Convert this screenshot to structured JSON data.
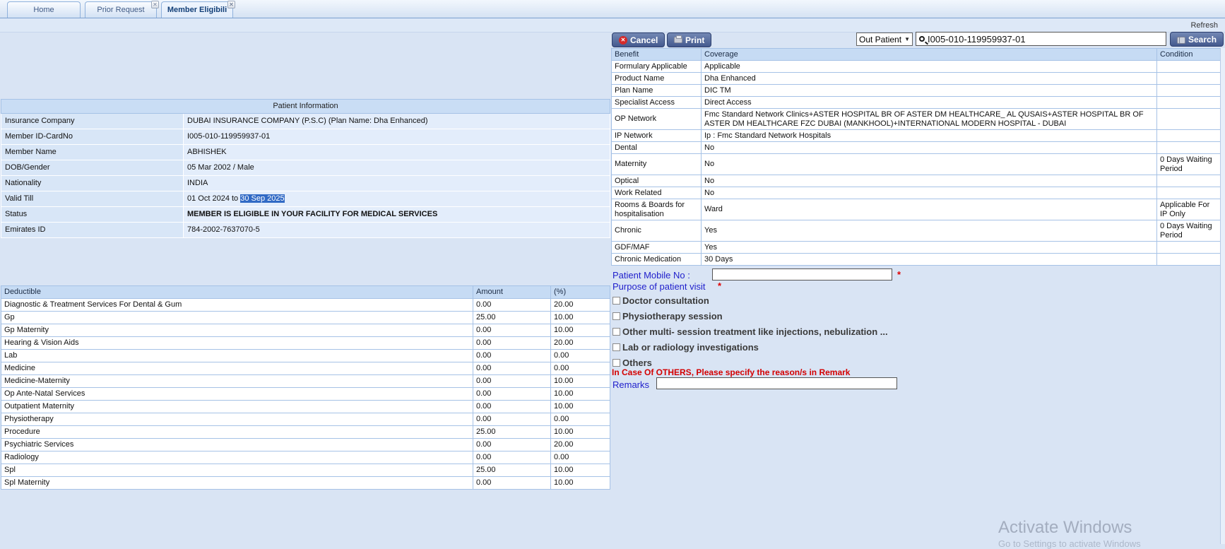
{
  "tabs": [
    {
      "label": "Home",
      "closable": false,
      "active": false
    },
    {
      "label": "Prior Request",
      "closable": true,
      "active": false
    },
    {
      "label": "Member Eligibili",
      "closable": true,
      "active": true
    }
  ],
  "toolbar": {
    "refresh_label": "Refresh"
  },
  "patient_info": {
    "title": "Patient Information",
    "rows": [
      {
        "label": "Insurance Company",
        "value": "DUBAI INSURANCE COMPANY (P.S.C) (Plan Name: Dha Enhanced)"
      },
      {
        "label": "Member ID-CardNo",
        "value": "I005-010-119959937-01"
      },
      {
        "label": "Member Name",
        "value": "ABHISHEK"
      },
      {
        "label": "DOB/Gender",
        "value": "05 Mar 2002 / Male"
      },
      {
        "label": "Nationality",
        "value": "INDIA"
      },
      {
        "label": "Valid Till",
        "value_prefix": "01 Oct 2024 to ",
        "value_highlight": "30 Sep 2025"
      },
      {
        "label": "Status",
        "value": "MEMBER IS ELIGIBLE IN YOUR FACILITY FOR MEDICAL SERVICES"
      },
      {
        "label": "Emirates ID",
        "value": "784-2002-7637070-5"
      }
    ]
  },
  "deductible_table": {
    "columns": [
      "Deductible",
      "Amount",
      "(%)"
    ],
    "rows": [
      [
        "Diagnostic & Treatment Services For Dental & Gum",
        "0.00",
        "20.00"
      ],
      [
        "Gp",
        "25.00",
        "10.00"
      ],
      [
        "Gp Maternity",
        "0.00",
        "10.00"
      ],
      [
        "Hearing & Vision Aids",
        "0.00",
        "20.00"
      ],
      [
        "Lab",
        "0.00",
        "0.00"
      ],
      [
        "Medicine",
        "0.00",
        "0.00"
      ],
      [
        "Medicine-Maternity",
        "0.00",
        "10.00"
      ],
      [
        "Op Ante-Natal Services",
        "0.00",
        "10.00"
      ],
      [
        "Outpatient Maternity",
        "0.00",
        "10.00"
      ],
      [
        "Physiotherapy",
        "0.00",
        "0.00"
      ],
      [
        "Procedure",
        "25.00",
        "10.00"
      ],
      [
        "Psychiatric Services",
        "0.00",
        "20.00"
      ],
      [
        "Radiology",
        "0.00",
        "0.00"
      ],
      [
        "Spl",
        "25.00",
        "10.00"
      ],
      [
        "Spl Maternity",
        "0.00",
        "10.00"
      ]
    ]
  },
  "actions": {
    "cancel_label": "Cancel",
    "print_label": "Print",
    "search_label": "Search"
  },
  "search": {
    "type_selected": "Out Patient",
    "query": "I005-010-119959937-01"
  },
  "benefit_table": {
    "columns": [
      "Benefit",
      "Coverage",
      "Condition"
    ],
    "rows": [
      [
        "Formulary Applicable",
        "Applicable",
        ""
      ],
      [
        "Product Name",
        "Dha Enhanced",
        ""
      ],
      [
        "Plan Name",
        "DIC TM",
        ""
      ],
      [
        "Specialist Access",
        "Direct Access",
        ""
      ],
      [
        "OP Network",
        "Fmc Standard Network Clinics+ASTER HOSPITAL BR OF ASTER DM HEALTHCARE_ AL QUSAIS+ASTER HOSPITAL BR OF ASTER DM HEALTHCARE FZC DUBAI (MANKHOOL)+INTERNATIONAL MODERN HOSPITAL - DUBAI",
        ""
      ],
      [
        "IP Network",
        "Ip : Fmc Standard Network Hospitals",
        ""
      ],
      [
        "Dental",
        "No",
        ""
      ],
      [
        "Maternity",
        "No",
        "0 Days Waiting Period"
      ],
      [
        "Optical",
        "No",
        ""
      ],
      [
        "Work Related",
        "No",
        ""
      ],
      [
        "Rooms & Boards for hospitalisation",
        "Ward",
        "Applicable For IP Only"
      ],
      [
        "Chronic",
        "Yes",
        "0 Days Waiting Period"
      ],
      [
        "GDF/MAF",
        "Yes",
        ""
      ],
      [
        "Chronic Medication",
        "30 Days",
        ""
      ]
    ]
  },
  "visit_form": {
    "mobile_label": "Patient Mobile No :",
    "mobile_value": "",
    "required_marker": "*",
    "purpose_label": "Purpose of patient visit",
    "options": [
      "Doctor consultation",
      "Physiotherapy session",
      "Other multi- session treatment like injections, nebulization ...",
      "Lab or radiology investigations",
      "Others"
    ],
    "others_note": "In Case Of OTHERS, Please specify the reason/s in Remark",
    "remarks_label": "Remarks",
    "remarks_value": ""
  },
  "watermark": {
    "line1": "Activate Windows",
    "line2": "Go to Settings to activate Windows"
  },
  "colors": {
    "accent_button": "#44598e",
    "selection": "#316ac5",
    "status_ok": "#0b8a0b",
    "link_blue": "#2121cc",
    "alert_red": "#d40000"
  }
}
